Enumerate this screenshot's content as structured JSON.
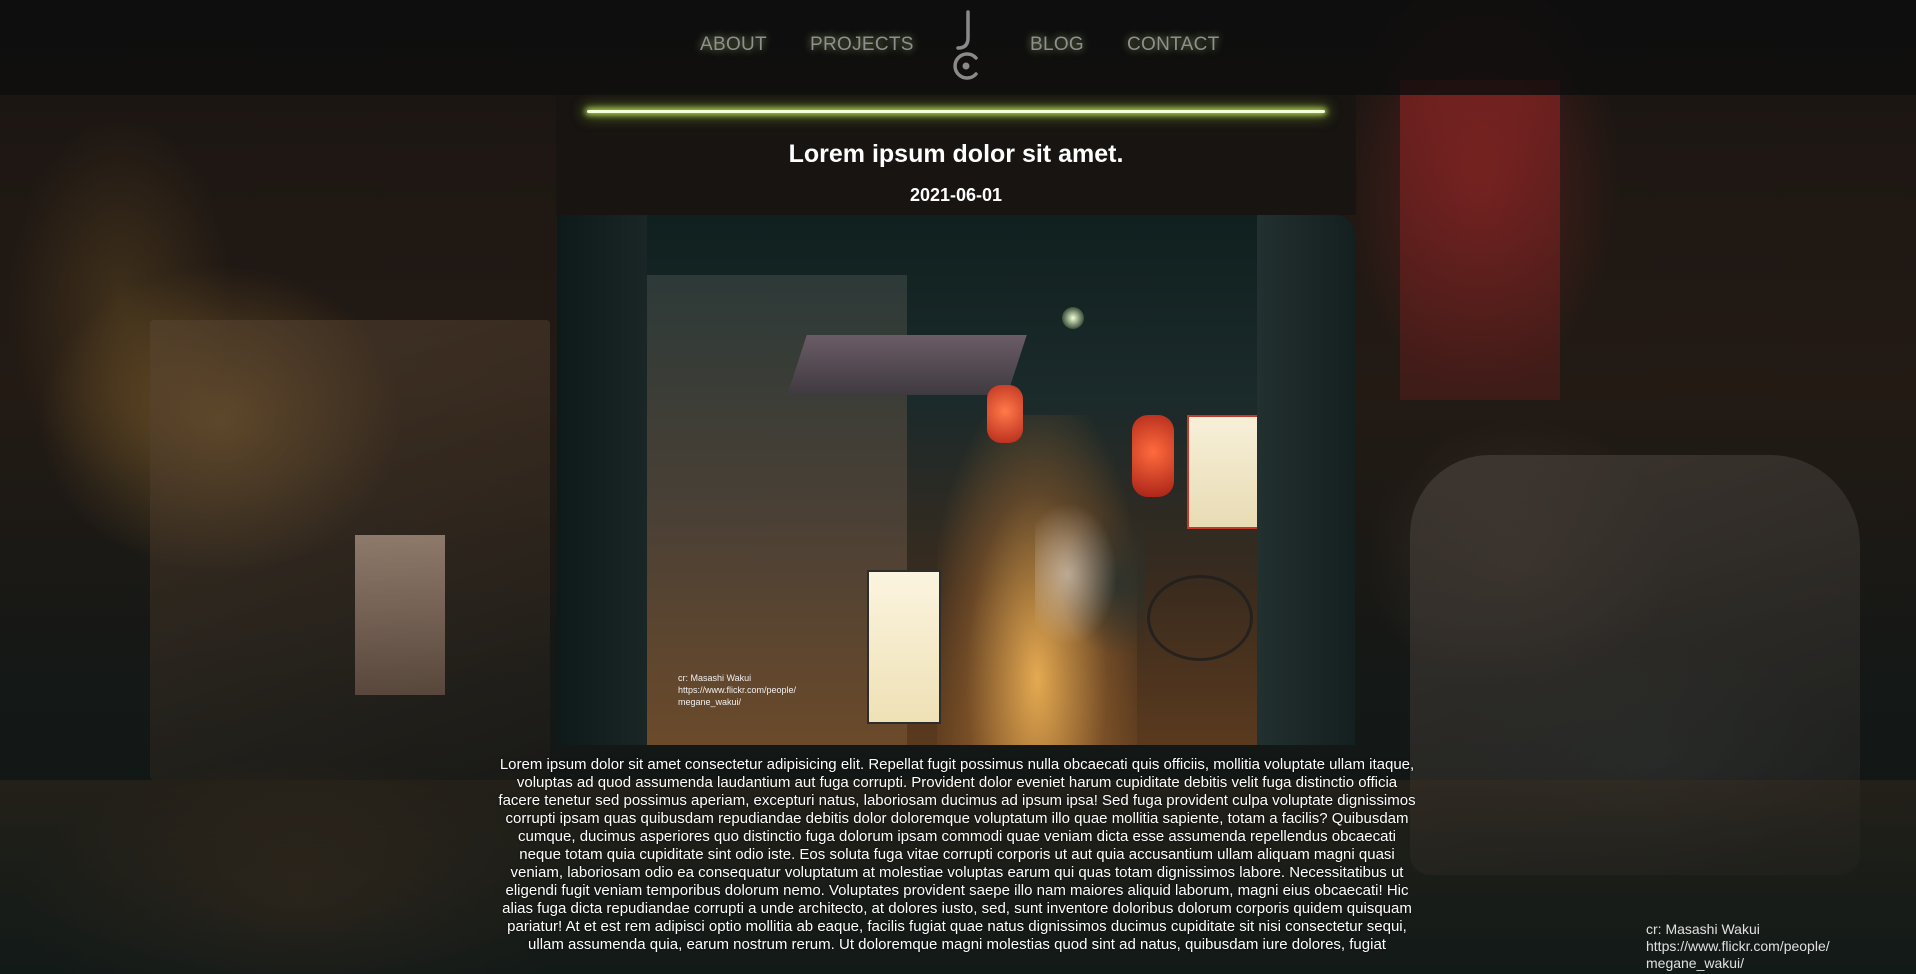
{
  "nav": {
    "links": [
      "ABOUT",
      "PROJECTS",
      "BLOG",
      "CONTACT"
    ],
    "logo_icon": "jc-monogram-logo"
  },
  "post": {
    "title": "Lorem ipsum dolor sit amet.",
    "date": "2021-06-01",
    "photo_credit": {
      "name": "cr: Masashi Wakui",
      "url_line1": "https://www.flickr.com/people/",
      "url_line2": "megane_wakui/"
    },
    "body": "Lorem ipsum dolor sit amet consectetur adipisicing elit. Repellat fugit possimus nulla obcaecati quis officiis, mollitia voluptate ullam itaque, voluptas ad quod assumenda laudantium aut fuga corrupti. Provident dolor eveniet harum cupiditate debitis velit fuga distinctio officia facere tenetur sed possimus aperiam, excepturi natus, laboriosam ducimus ad ipsum ipsa! Sed fuga provident culpa voluptate dignissimos corrupti ipsam quas quibusdam repudiandae debitis dolor doloremque voluptatum illo quae mollitia sapiente, totam a facilis? Quibusdam cumque, ducimus asperiores quo distinctio fuga dolorum ipsam commodi quae veniam dicta esse assumenda repellendus obcaecati neque totam quia cupiditate sint odio iste. Eos soluta fuga vitae corrupti corporis ut aut quia accusantium ullam aliquam magni quasi veniam, laboriosam odio ea consequatur voluptatum at molestiae voluptas earum qui quas totam dignissimos labore. Necessitatibus ut eligendi fugit veniam temporibus dolorum nemo. Voluptates provident saepe illo nam maiores aliquid laborum, magni eius obcaecati! Hic alias fuga dicta repudiandae corrupti a unde architecto, at dolores iusto, sed, sunt inventore doloribus dolorum corporis quidem quisquam pariatur! At et est rem adipisci optio mollitia ab eaque, facilis fugiat quae natus dignissimos ducimus cupiditate sit nisi consectetur sequi, ullam assumenda quia, earum nostrum rerum. Ut doloremque magni molestias quod sint ad natus, quibusdam iure dolores, fugiat"
  },
  "background_credit": {
    "name": "cr: Masashi Wakui",
    "url_line1": "https://www.flickr.com/people/",
    "url_line2": "megane_wakui/"
  },
  "colors": {
    "nav_text": "#8f8f8f",
    "glow_accent": "#d2ff6e",
    "text": "#ffffff"
  }
}
